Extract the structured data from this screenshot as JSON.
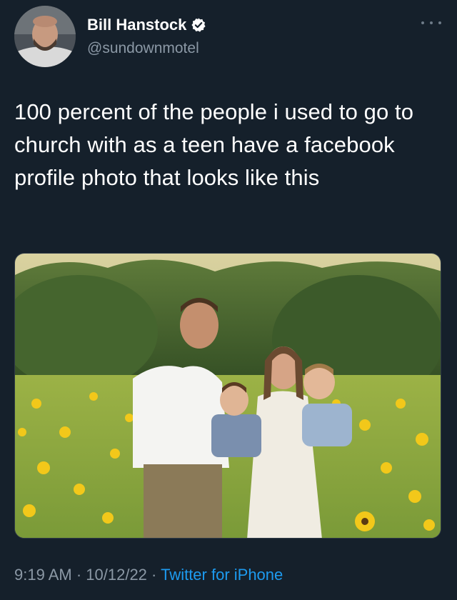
{
  "author": {
    "display_name": "Bill Hanstock",
    "handle": "@sundownmotel",
    "verified": true
  },
  "tweet": {
    "text": "100 percent of the people i used to go to church with as a teen have a facebook profile photo that looks like this"
  },
  "meta": {
    "time": "9:19 AM",
    "separator": " · ",
    "date": "10/12/22",
    "source": "Twitter for iPhone"
  },
  "colors": {
    "background": "#15202b",
    "text": "#ffffff",
    "secondary": "#8b98a5",
    "accent": "#1d9bf0"
  },
  "icons": {
    "verified": "verified-badge-icon",
    "more": "more-options-icon"
  }
}
